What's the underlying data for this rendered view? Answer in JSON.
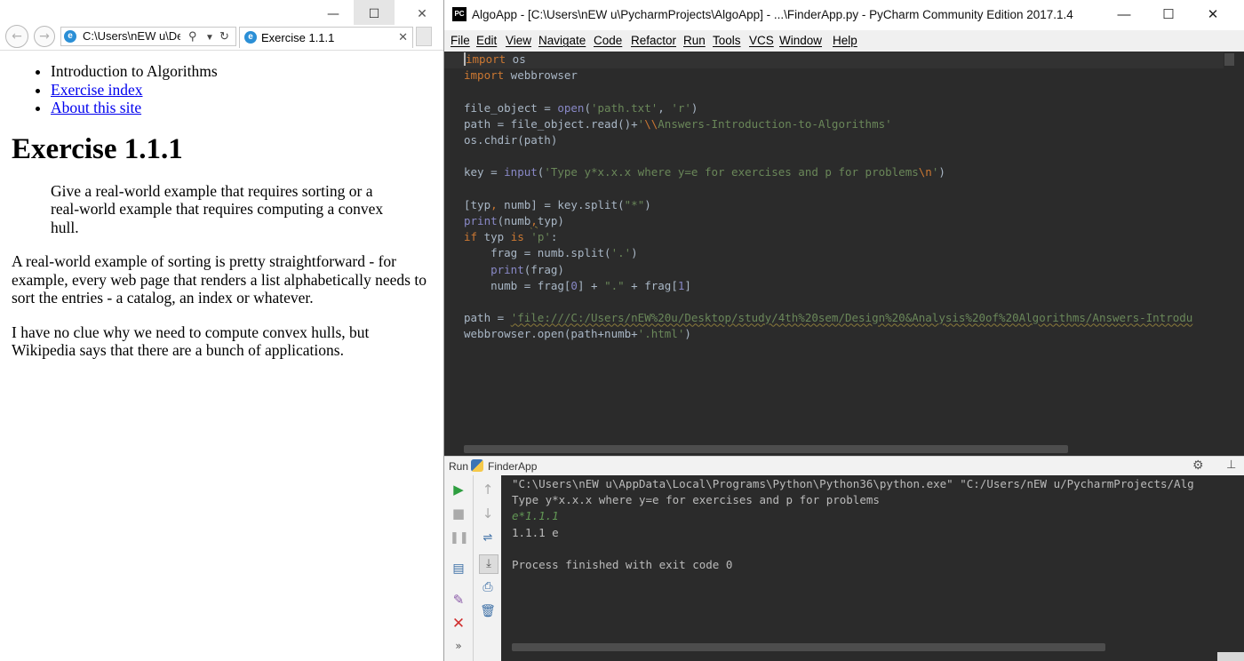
{
  "browser": {
    "address": "C:\\Users\\nEW u\\Des",
    "tab_title": "Exercise 1.1.1",
    "window_controls": {
      "minimize": "—",
      "maximize": "☐",
      "close": "✕"
    },
    "page": {
      "nav": [
        "Introduction to Algorithms",
        "Exercise index",
        "About this site"
      ],
      "heading": "Exercise 1.1.1",
      "question": "Give a real-world example that requires sorting or a real-world example that requires computing a convex hull.",
      "answer_p1": "A real-world example of sorting is pretty straightforward - for example, every web page that renders a list alphabetically needs to sort the entries - a catalog, an index or whatever.",
      "answer_p2": "I have no clue why we need to compute convex hulls, but Wikipedia says that there are a bunch of applications."
    }
  },
  "ide": {
    "logo": "PC",
    "title": "AlgoApp - [C:\\Users\\nEW u\\PycharmProjects\\AlgoApp] - ...\\FinderApp.py - PyCharm Community Edition 2017.1.4",
    "menu": [
      "File",
      "Edit",
      "View",
      "Navigate",
      "Code",
      "Refactor",
      "Run",
      "Tools",
      "VCS",
      "Window",
      "Help"
    ],
    "run_tab_label": "Run",
    "run_config": "FinderApp",
    "console": {
      "command": "\"C:\\Users\\nEW u\\AppData\\Local\\Programs\\Python\\Python36\\python.exe\" \"C:/Users/nEW u/PycharmProjects/Alg",
      "prompt": "Type y*x.x.x where y=e for exercises and p for problems",
      "user_input": "e*1.1.1",
      "output": "1.1.1 e",
      "exit": "Process finished with exit code 0"
    },
    "colors": {
      "editor_bg": "#2b2b2b",
      "keyword": "#cc7832",
      "string": "#6a8759",
      "builtin": "#8888c6",
      "text": "#a9b7c6"
    }
  }
}
